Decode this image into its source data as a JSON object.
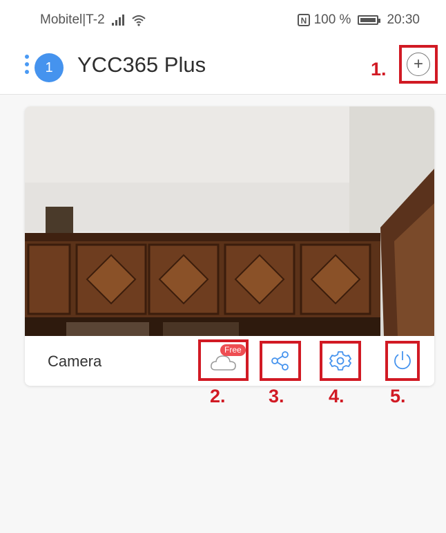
{
  "status_bar": {
    "carrier": "Mobitel|T-2",
    "nfc_symbol": "N",
    "battery_text": "100 %",
    "time": "20:30"
  },
  "header": {
    "device_count": "1",
    "title": "YCC365 Plus",
    "add_device_icon": "plus-circle-icon"
  },
  "annotations": {
    "step1": "1.",
    "step2": "2.",
    "step3": "3.",
    "step4": "4.",
    "step5": "5."
  },
  "camera_card": {
    "name": "Camera",
    "cloud_badge": "Free",
    "actions": [
      {
        "icon": "cloud-icon"
      },
      {
        "icon": "share-icon"
      },
      {
        "icon": "settings-icon"
      },
      {
        "icon": "power-icon"
      }
    ]
  },
  "colors": {
    "accent_blue": "#4593ee",
    "annotation_red": "#d11a24",
    "badge_red": "#ee4d52"
  }
}
